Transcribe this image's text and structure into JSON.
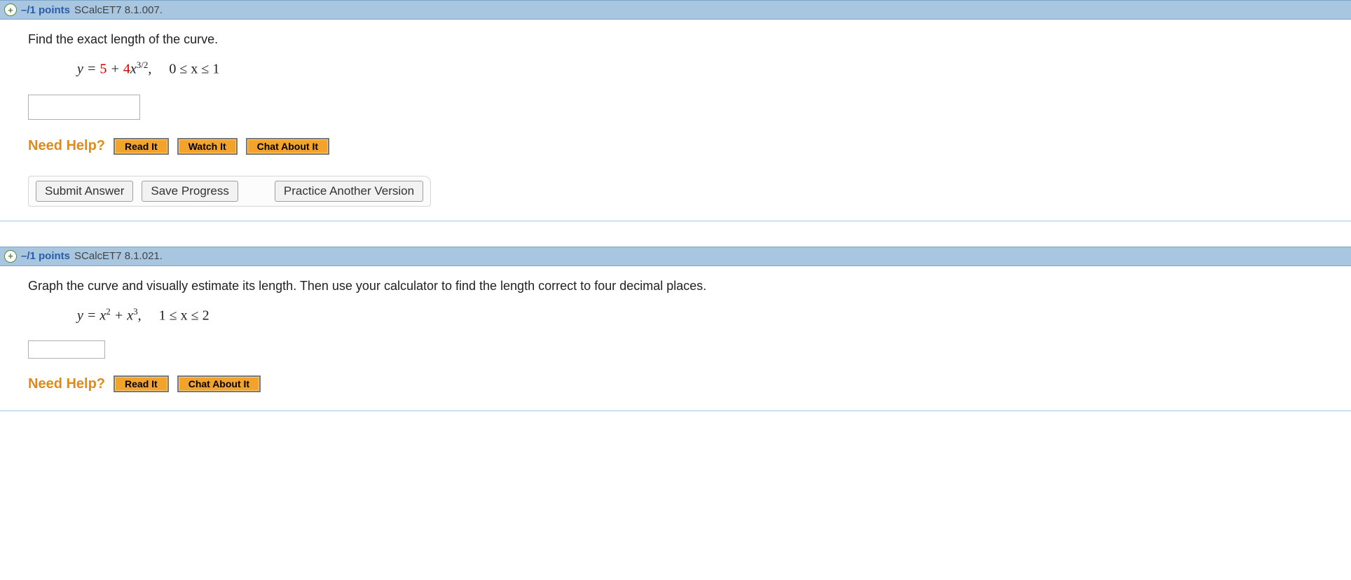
{
  "q1": {
    "header_points": "–/1 points",
    "header_source": "SCalcET7 8.1.007.",
    "prompt": "Find the exact length of the curve.",
    "equation": {
      "prefix": "y = ",
      "coef1": "5",
      "mid": " + ",
      "coef2": "4",
      "var": "x",
      "exp": "3/2",
      "tail": ",  0 ≤ x ≤ 1"
    },
    "need_help": "Need Help?",
    "read_it": "Read It",
    "watch_it": "Watch It",
    "chat": "Chat About It",
    "submit": "Submit Answer",
    "save": "Save Progress",
    "practice": "Practice Another Version"
  },
  "q2": {
    "header_points": "–/1 points",
    "header_source": "SCalcET7 8.1.021.",
    "prompt": "Graph the curve and visually estimate its length. Then use your calculator to find the length correct to four decimal places.",
    "equation": {
      "prefix": "y = x",
      "exp1": "2",
      "mid": " + x",
      "exp2": "3",
      "tail": ",  1 ≤ x ≤ 2"
    },
    "need_help": "Need Help?",
    "read_it": "Read It",
    "chat": "Chat About It"
  }
}
